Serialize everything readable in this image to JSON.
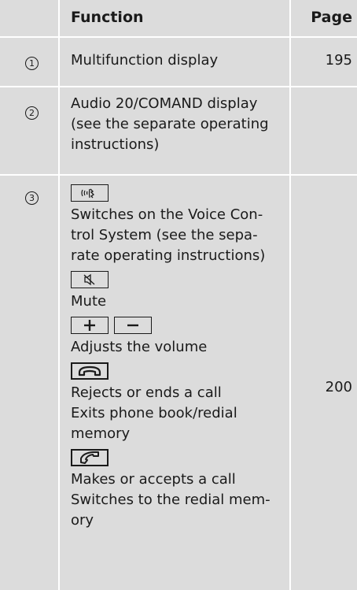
{
  "header": {
    "function": "Function",
    "page": "Page"
  },
  "rows": [
    {
      "number": "1",
      "function_lines": [
        "Multifunction display"
      ],
      "page": "195"
    },
    {
      "number": "2",
      "function_lines": [
        "Audio 20/COMAND display",
        "(see the separate operating",
        "instructions)"
      ],
      "page": ""
    },
    {
      "number": "3",
      "page": "200",
      "items": {
        "voice_icon": "voice-control-button-icon",
        "voice_lines": [
          "Switches on the Voice Con-",
          "trol System (see the sepa-",
          "rate operating instructions)"
        ],
        "mute_icon": "mute-button-icon",
        "mute_label": "Mute",
        "plus_icon": "volume-up-button-icon",
        "minus_icon": "volume-down-button-icon",
        "volume_label": "Adjusts the volume",
        "end_call_icon": "end-call-button-icon",
        "end_call_lines": [
          "Rejects or ends a call",
          "Exits phone book/redial",
          "memory"
        ],
        "accept_call_icon": "accept-call-button-icon",
        "accept_call_lines": [
          "Makes or accepts a call",
          "Switches to the redial mem-",
          "ory"
        ]
      }
    }
  ],
  "colors": {
    "cell_background": "#dcdcdc",
    "text": "#1a1a1a"
  }
}
